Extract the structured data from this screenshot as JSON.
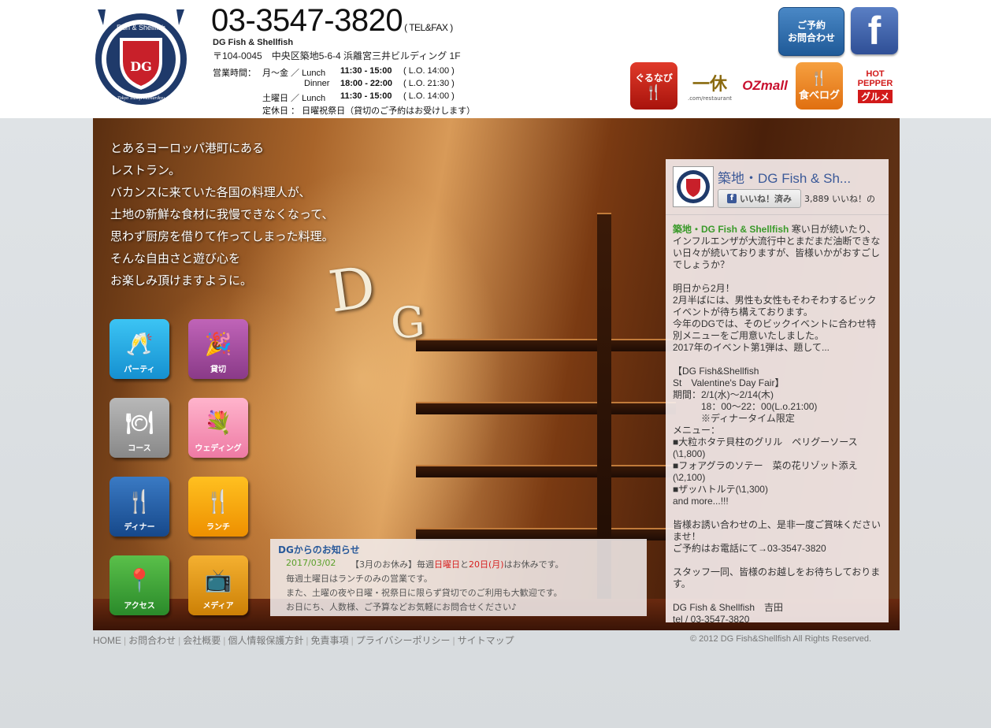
{
  "header": {
    "logo_text": "Fish & Shellfish",
    "logo_mark": "DG",
    "logo_subtext": "Tokyo Tsukiji Hamarikyu",
    "phone": "03-3547-3820",
    "phone_note": "( TEL&FAX )",
    "restaurant_name": "DG Fish & Shellfish",
    "address": "〒104-0045　中央区築地5-6-4 浜離宮三井ビルディング 1F",
    "hours": {
      "label": "営業時間：",
      "weekday": "月～金 ／ Lunch",
      "weekday_lunch_time": "11:30 - 15:00",
      "weekday_lunch_lo": "( L.O. 14:00 )",
      "dinner_label": "Dinner",
      "dinner_time": "18:00 - 22:00",
      "dinner_lo": "( L.O. 21:30 )",
      "saturday": "土曜日 ／ Lunch",
      "saturday_lunch_time": "11:30 - 15:00",
      "saturday_lunch_lo": "( L.O. 14:00 )",
      "closed": "定休日 ： 日曜祝祭日（貸切のご予約はお受けします）"
    },
    "buttons": {
      "reserve": "ご予約\nお問合わせ",
      "facebook": "f",
      "gurunavi": "ぐるなび",
      "ikkyu": "一休",
      "ikkyu_sub": ".com/restaurant",
      "ozmall": "OZmall",
      "tabelog": "食べログ",
      "hotpepper_top": "HOT PEPPER",
      "hotpepper_bottom": "グルメ"
    }
  },
  "hero": {
    "tagline": [
      "とあるヨーロッパ港町にある",
      "レストラン。",
      "バカンスに来ていた各国の料理人が、",
      "土地の新鮮な食材に我慢できなくなって、",
      "思わず厨房を借りて作ってしまった料理。",
      "そんな自由さと遊び心を",
      "お楽しみ頂けますように。"
    ],
    "nav": [
      {
        "label": "パーティ",
        "color": "#1aa6e0"
      },
      {
        "label": "貸切",
        "color": "#a0489a"
      },
      {
        "label": "コース",
        "color": "#9a9a9a"
      },
      {
        "label": "ウェディング",
        "color": "#f08ab0"
      },
      {
        "label": "ディナー",
        "color": "#1f5aa0"
      },
      {
        "label": "ランチ",
        "color": "#f5a000"
      },
      {
        "label": "アクセス",
        "color": "#3aa03a"
      },
      {
        "label": "メディア",
        "color": "#e09a10"
      }
    ]
  },
  "notice": {
    "title": "DGからのお知らせ",
    "date": "2017/03/02",
    "line1_a": "【3月のお休み】毎週",
    "line1_b": "日曜日",
    "line1_c": "と",
    "line1_d": "20日(月)",
    "line1_e": "はお休みです。",
    "line2": "毎週土曜日はランチのみの営業です。",
    "line3": "また、土曜の夜や日曜・祝祭日に限らず貸切でのご利用も大歓迎です。",
    "line4": "お日にち、人数様、ご予算などお気軽にお問合せください♪"
  },
  "facebook": {
    "page_name": "築地・DG Fish & Sh...",
    "like_button": "いいね！済み",
    "like_count": "3,889 いいね！の",
    "author": "築地・DG Fish & Shellfish",
    "post": [
      " 寒い日が続いたり、インフルエンザが大流行中とまだまだ油断できない日々が続いておりますが、皆様いかがおすごしでしょうか？",
      "",
      "明日から2月！",
      "2月半ばには、男性も女性もそわそわするビックイベントが待ち構えております。",
      "今年のDGでは、そのビックイベントに合わせ特別メニューをご用意いたしました。",
      "2017年のイベント第1弾は、題して...",
      "",
      "【DG Fish&Shellfish",
      "St　Valentine's Day Fair】",
      "期間：2/1(水)～2/14(木)",
      "　　　18：00～22：00(L.o.21:00)",
      "　　　※ディナータイム限定",
      "メニュー：",
      "■大粒ホタテ貝柱のグリル　ペリグーソース(\\1,800)",
      "■フォアグラのソテー　菜の花リゾット添え(\\2,100)",
      "■ザッハトルテ(\\1,300)",
      "and more...!!!",
      "",
      "皆様お誘い合わせの上、是非一度ご賞味くださいませ！",
      "ご予約はお電話にて→03-3547-3820",
      "",
      "スタッフ一同、皆様のお越しをお待ちしております。",
      "",
      "DG Fish & Shellfish　吉田",
      "tel / 03-3547-3820"
    ]
  },
  "footer": {
    "links": [
      "HOME",
      "お問合わせ",
      "会社概要",
      "個人情報保護方針",
      "免責事項",
      "プライバシーポリシー",
      "サイトマップ"
    ],
    "copyright": "© 2012 DG Fish&Shellfish All Rights Reserved."
  }
}
